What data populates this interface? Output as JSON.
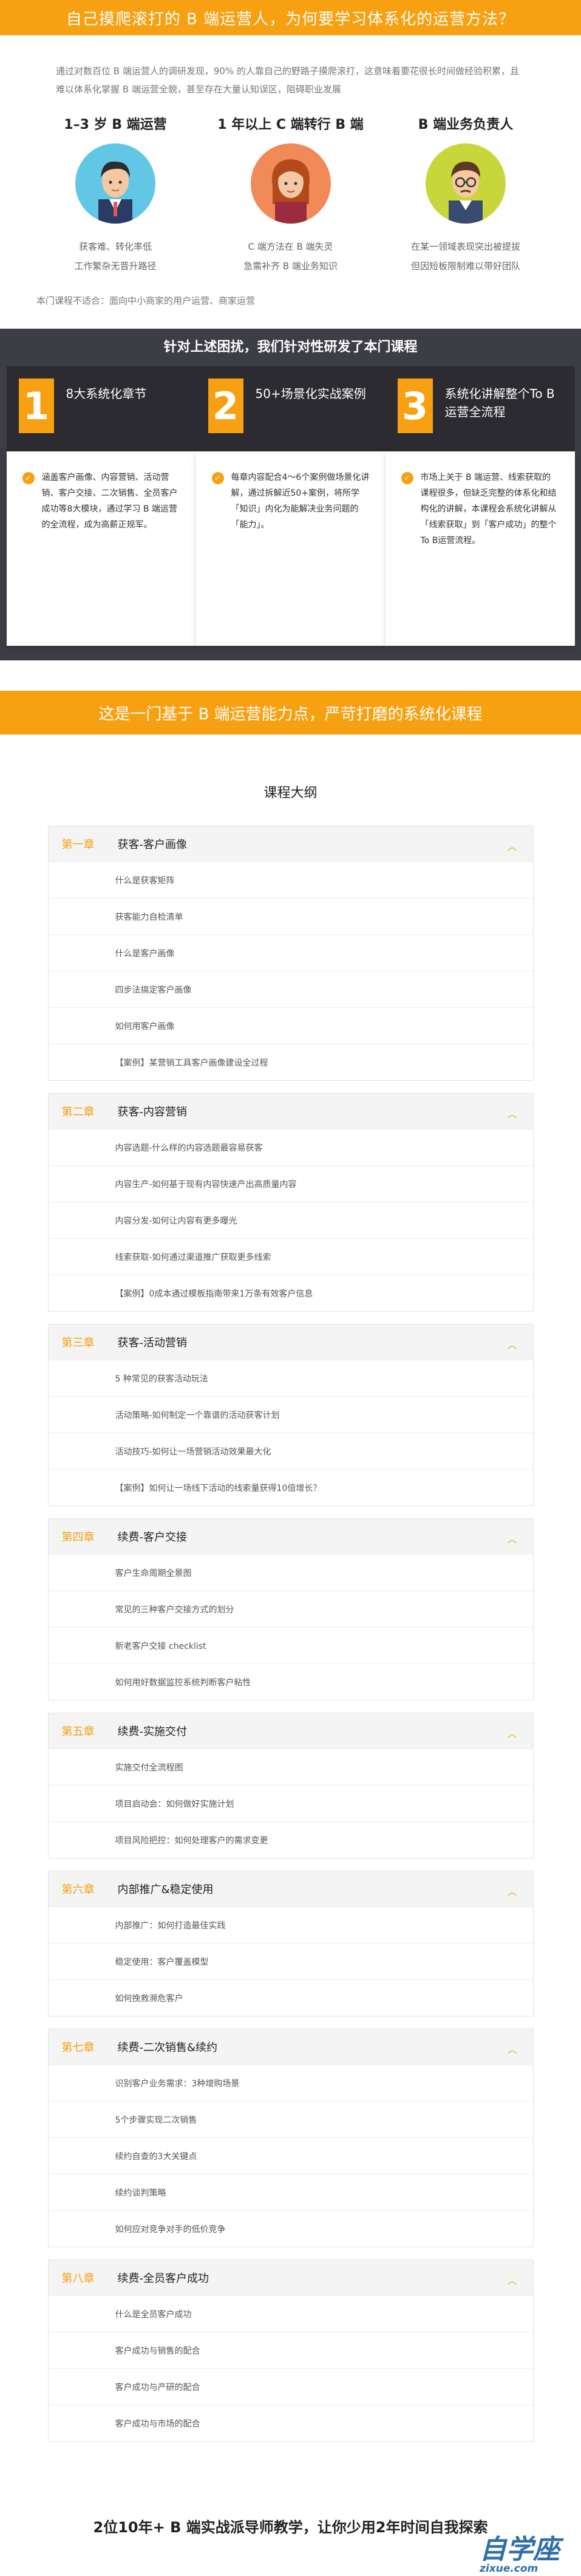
{
  "banner": {
    "title": "自己摸爬滚打的 B 端运营人，为何要学习体系化的运营方法？"
  },
  "intro": {
    "text": "通过对数百位 B 端运营人的调研发现，90% 的人靠自己的野路子摸爬滚打，这意味着要花很长时间做经验积累，且难以体系化掌握 B 端运营全貌，甚至存在大量认知误区，阻碍职业发展"
  },
  "roles": [
    {
      "title": "1–3 岁 B 端运营",
      "desc": [
        "获客难、转化率低",
        "工作繁杂无晋升路径"
      ]
    },
    {
      "title": "1 年以上 C 端转行 B 端",
      "desc": [
        "C 端方法在 B 端失灵",
        "急需补齐 B 端业务知识"
      ]
    },
    {
      "title": "B 端业务负责人",
      "desc": [
        "在某一领域表现突出被提拔",
        "但因短板限制难以带好团队"
      ]
    }
  ],
  "not_suitable": "本门课程不适合：面向中小商家的用户运营、商家运营",
  "features": {
    "title": "针对上述困扰，我们针对性研发了本门课程",
    "cards": [
      {
        "num": "1",
        "name": "8大系统化章节",
        "text": "涵盖客户画像、内容营销、活动营销、客户交接、二次销售、全员客户成功等8大模块，通过学习 B 端运营的全流程，成为高薪正规军。"
      },
      {
        "num": "2",
        "name": "50+场景化实战案例",
        "text": "每章内容配合4～6个案例做场景化讲解，通过拆解近50+案例，将所学「知识」内化为能解决业务问题的「能力」。"
      },
      {
        "num": "3",
        "name": "系统化讲解整个To B运营全流程",
        "text": "市场上关于 B 端运营、线索获取的课程很多，但缺乏完整的体系化和结构化的讲解，本课程会系统化讲解从「线索获取」到「客户成功」的整个To B运营流程。"
      }
    ]
  },
  "slogan": "这是一门基于 B 端运营能力点，严苛打磨的系统化课程",
  "syllabus": {
    "title": "课程大纲",
    "chapters": [
      {
        "no": "第一章",
        "name": "获客-客户画像",
        "lessons": [
          "什么是获客矩阵",
          "获客能力自检清单",
          "什么是客户画像",
          "四步法搞定客户画像",
          "如何用客户画像",
          "【案例】某营销工具客户画像建设全过程"
        ]
      },
      {
        "no": "第二章",
        "name": "获客-内容营销",
        "lessons": [
          "内容选题-什么样的内容选题最容易获客",
          "内容生产-如何基于现有内容快速产出高质量内容",
          "内容分发-如何让内容有更多曝光",
          "线索获取-如何通过渠道推广获取更多线索",
          "【案例】0成本通过模板指南带来1万条有效客户信息"
        ]
      },
      {
        "no": "第三章",
        "name": "获客-活动营销",
        "lessons": [
          "5 种常见的获客活动玩法",
          "活动策略-如何制定一个靠谱的活动获客计划",
          "活动技巧-如何让一场营销活动效果最大化",
          "【案例】如何让一场线下活动的线索量获得10倍增长？"
        ]
      },
      {
        "no": "第四章",
        "name": "续费-客户交接",
        "lessons": [
          "客户生命周期全景图",
          "常见的三种客户交接方式的划分",
          "新老客户交接 checklist",
          "如何用好数据监控系统判断客户粘性"
        ]
      },
      {
        "no": "第五章",
        "name": "续费-实施交付",
        "lessons": [
          "实施交付全流程图",
          "项目启动会：如何做好实施计划",
          "项目风险把控：如何处理客户的需求变更"
        ]
      },
      {
        "no": "第六章",
        "name": "内部推广&稳定使用",
        "lessons": [
          "内部推广：如何打造最佳实践",
          "稳定使用：客户覆盖模型",
          "如何挽救濒危客户"
        ]
      },
      {
        "no": "第七章",
        "name": "续费-二次销售&续约",
        "lessons": [
          "识别客户业务需求：3种增购场景",
          "5个步骤实现二次销售",
          "续约自查的3大关键点",
          "续约谈判策略",
          "如何应对竞争对手的低价竞争"
        ]
      },
      {
        "no": "第八章",
        "name": "续费-全员客户成功",
        "lessons": [
          "什么是全员客户成功",
          "客户成功与销售的配合",
          "客户成功与产研的配合",
          "客户成功与市场的配合"
        ]
      }
    ]
  },
  "bottom_line": "2位10年+ B 端实战派导师教学，让你少用2年时间自我探索",
  "watermark": {
    "main": "自学座",
    "sub": "zixue.com"
  },
  "colors": {
    "accent": "#f7a011",
    "dark": "#3d3d46"
  },
  "icons": {
    "check": "check-icon",
    "chevron": "chevron-up-icon"
  }
}
